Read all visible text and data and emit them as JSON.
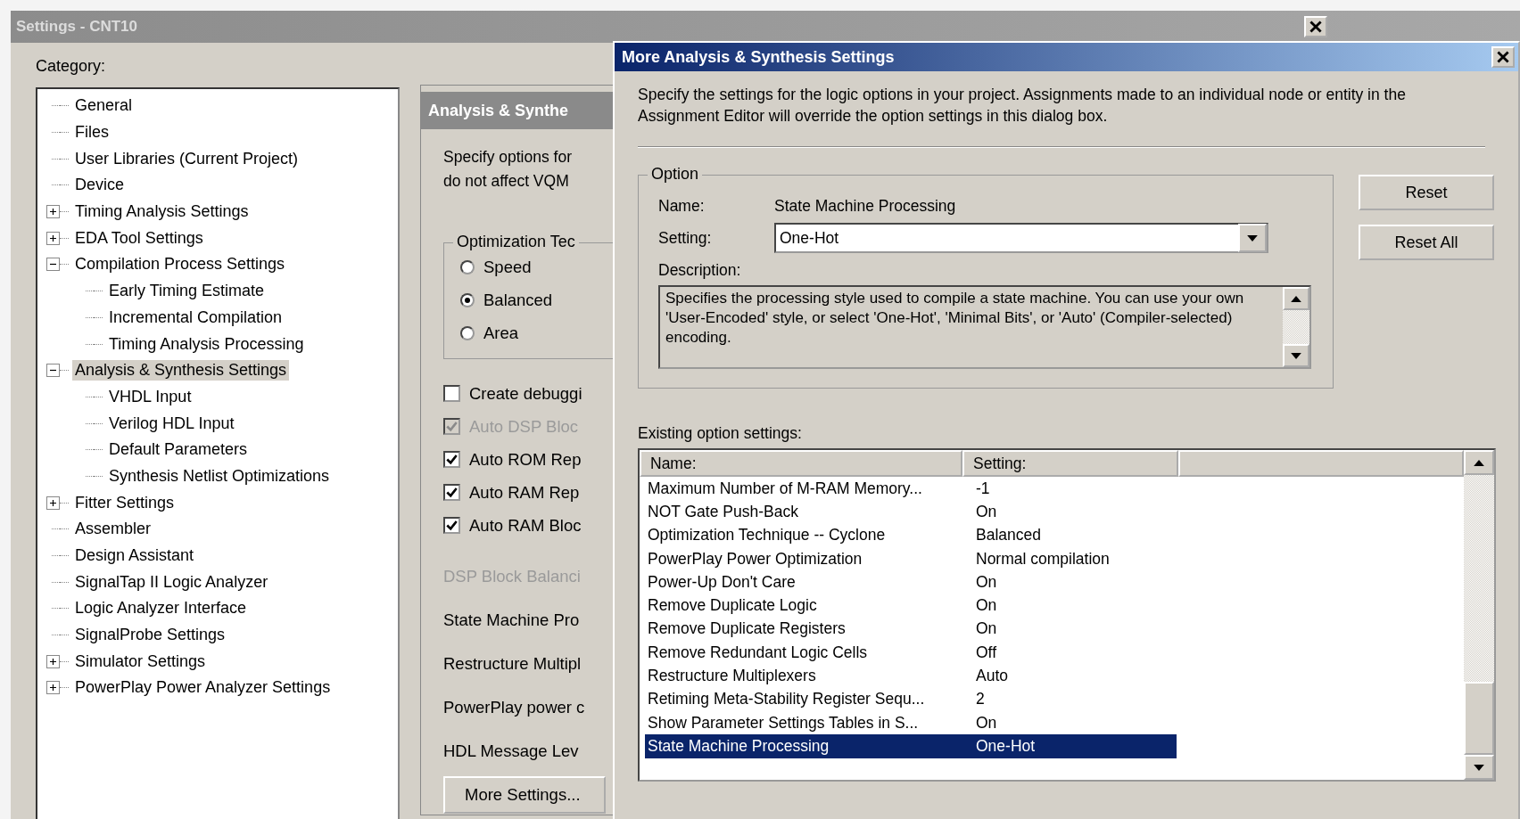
{
  "window": {
    "title": "Settings - CNT10"
  },
  "category_label": "Category:",
  "tree": [
    {
      "label": "General",
      "kind": "leaf",
      "selected": false
    },
    {
      "label": "Files",
      "kind": "leaf",
      "selected": false
    },
    {
      "label": "User Libraries (Current Project)",
      "kind": "leaf",
      "selected": false
    },
    {
      "label": "Device",
      "kind": "leaf",
      "selected": false
    },
    {
      "label": "Timing Analysis Settings",
      "kind": "node",
      "expanded": false,
      "selected": false
    },
    {
      "label": "EDA Tool Settings",
      "kind": "node",
      "expanded": false,
      "selected": false
    },
    {
      "label": "Compilation Process Settings",
      "kind": "node",
      "expanded": true,
      "selected": false,
      "children": [
        {
          "label": "Early Timing Estimate",
          "kind": "leaf",
          "selected": false
        },
        {
          "label": "Incremental Compilation",
          "kind": "leaf",
          "selected": false
        },
        {
          "label": "Timing Analysis Processing",
          "kind": "leaf",
          "selected": false
        }
      ]
    },
    {
      "label": "Analysis & Synthesis Settings",
      "kind": "node",
      "expanded": true,
      "selected": true,
      "children": [
        {
          "label": "VHDL Input",
          "kind": "leaf",
          "selected": false
        },
        {
          "label": "Verilog HDL Input",
          "kind": "leaf",
          "selected": false
        },
        {
          "label": "Default Parameters",
          "kind": "leaf",
          "selected": false
        },
        {
          "label": "Synthesis Netlist Optimizations",
          "kind": "leaf",
          "selected": false
        }
      ]
    },
    {
      "label": "Fitter Settings",
      "kind": "node",
      "expanded": false,
      "selected": false
    },
    {
      "label": "Assembler",
      "kind": "leaf",
      "selected": false
    },
    {
      "label": "Design Assistant",
      "kind": "leaf",
      "selected": false
    },
    {
      "label": "SignalTap II Logic Analyzer",
      "kind": "leaf",
      "selected": false
    },
    {
      "label": "Logic Analyzer Interface",
      "kind": "leaf",
      "selected": false
    },
    {
      "label": "SignalProbe Settings",
      "kind": "leaf",
      "selected": false
    },
    {
      "label": "Simulator Settings",
      "kind": "node",
      "expanded": false,
      "selected": false
    },
    {
      "label": "PowerPlay Power Analyzer Settings",
      "kind": "node",
      "expanded": false,
      "selected": false
    }
  ],
  "panel": {
    "header": "Analysis & Synthe",
    "intro": [
      "Specify options for",
      "do not affect VQM"
    ],
    "group": {
      "label": "Optimization Tec",
      "options": [
        {
          "label": "Speed",
          "selected": false
        },
        {
          "label": "Balanced",
          "selected": true
        },
        {
          "label": "Area",
          "selected": false
        }
      ]
    },
    "checks": [
      {
        "label": "Create debuggi",
        "checked": false,
        "disabled": false
      },
      {
        "label": "Auto DSP Bloc",
        "checked": true,
        "disabled": true
      },
      {
        "label": "Auto ROM Rep",
        "checked": true,
        "disabled": false
      },
      {
        "label": "Auto RAM Rep",
        "checked": true,
        "disabled": false
      },
      {
        "label": "Auto RAM Bloc",
        "checked": true,
        "disabled": false
      }
    ],
    "fields": [
      {
        "label": "DSP Block Balanci",
        "disabled": true
      },
      {
        "label": "State Machine Pro",
        "disabled": false
      },
      {
        "label": "Restructure Multipl",
        "disabled": false
      },
      {
        "label": "PowerPlay power c",
        "disabled": false
      },
      {
        "label": "HDL Message Lev",
        "disabled": false
      }
    ],
    "button": "More Settings..."
  },
  "dialog": {
    "title": "More Analysis & Synthesis Settings",
    "intro": "Specify the settings for the logic options in your project.  Assignments made to an individual node or entity in the Assignment Editor will override the option settings in this dialog box.",
    "option": {
      "legend": "Option",
      "name_label": "Name:",
      "name_value": "State Machine Processing",
      "setting_label": "Setting:",
      "setting_value": "One-Hot",
      "description_label": "Description:",
      "description": "Specifies the processing style used to compile a state machine. You can use your own 'User-Encoded' style, or select 'One-Hot', 'Minimal Bits', or 'Auto' (Compiler-selected) encoding."
    },
    "buttons": [
      "Reset",
      "Reset All"
    ],
    "list_label": "Existing option settings:",
    "columns": [
      "Name:",
      "Setting:"
    ],
    "rows": [
      {
        "name": "Maximum Number of M-RAM Memory...",
        "setting": "-1",
        "selected": false
      },
      {
        "name": "NOT Gate Push-Back",
        "setting": "On",
        "selected": false
      },
      {
        "name": "Optimization Technique -- Cyclone",
        "setting": "Balanced",
        "selected": false
      },
      {
        "name": "PowerPlay Power Optimization",
        "setting": "Normal compilation",
        "selected": false
      },
      {
        "name": "Power-Up Don't Care",
        "setting": "On",
        "selected": false
      },
      {
        "name": "Remove Duplicate Logic",
        "setting": "On",
        "selected": false
      },
      {
        "name": "Remove Duplicate Registers",
        "setting": "On",
        "selected": false
      },
      {
        "name": "Remove Redundant Logic Cells",
        "setting": "Off",
        "selected": false
      },
      {
        "name": "Restructure Multiplexers",
        "setting": "Auto",
        "selected": false
      },
      {
        "name": "Retiming Meta-Stability Register Sequ...",
        "setting": "2",
        "selected": false
      },
      {
        "name": "Show Parameter Settings Tables in S...",
        "setting": "On",
        "selected": false
      },
      {
        "name": "State Machine Processing",
        "setting": "One-Hot",
        "selected": true
      }
    ]
  }
}
